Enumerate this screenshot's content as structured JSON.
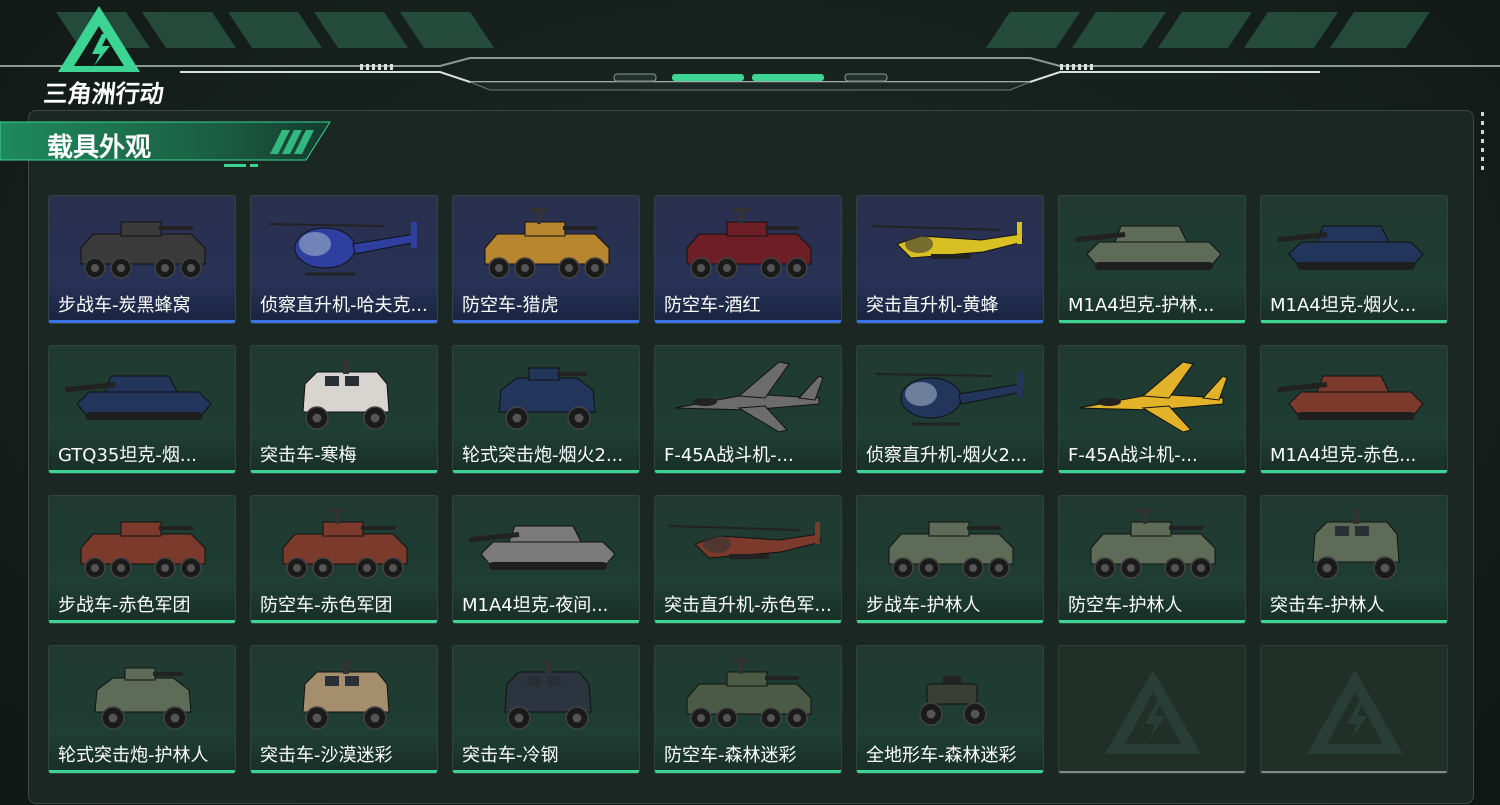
{
  "app": {
    "logo_text": "三角洲行动"
  },
  "section": {
    "title": "载具外观"
  },
  "colors": {
    "accent": "#3bd493",
    "rare": "#3a73e8",
    "empty": "#7f8a86"
  },
  "vehicles": [
    {
      "label": "步战车-炭黑蜂窝",
      "rarity": "rare",
      "icon": "ifv-icon",
      "tint": "#3a3a3a"
    },
    {
      "label": "侦察直升机-哈夫克...",
      "rarity": "rare",
      "icon": "scout-helicopter-icon",
      "tint": "#2f3fa0"
    },
    {
      "label": "防空车-猎虎",
      "rarity": "rare",
      "icon": "aa-vehicle-icon",
      "tint": "#b8862e"
    },
    {
      "label": "防空车-酒红",
      "rarity": "rare",
      "icon": "aa-vehicle-icon",
      "tint": "#6e1f26"
    },
    {
      "label": "突击直升机-黄蜂",
      "rarity": "rare",
      "icon": "attack-helicopter-icon",
      "tint": "#d8c024"
    },
    {
      "label": "M1A4坦克-护林...",
      "rarity": "common",
      "icon": "tank-icon",
      "tint": "#5d6b57"
    },
    {
      "label": "M1A4坦克-烟火...",
      "rarity": "common",
      "icon": "tank-icon",
      "tint": "#22355a"
    },
    {
      "label": "GTQ35坦克-烟...",
      "rarity": "common",
      "icon": "tank-icon",
      "tint": "#22355a"
    },
    {
      "label": "突击车-寒梅",
      "rarity": "common",
      "icon": "assault-vehicle-icon",
      "tint": "#d8d4d0"
    },
    {
      "label": "轮式突击炮-烟火2...",
      "rarity": "common",
      "icon": "wheeled-gun-icon",
      "tint": "#22355a"
    },
    {
      "label": "F-45A战斗机-...",
      "rarity": "common",
      "icon": "fighter-jet-icon",
      "tint": "#6c6c6c"
    },
    {
      "label": "侦察直升机-烟火2...",
      "rarity": "common",
      "icon": "scout-helicopter-icon",
      "tint": "#22355a"
    },
    {
      "label": "F-45A战斗机-...",
      "rarity": "common",
      "icon": "fighter-jet-icon",
      "tint": "#e2b228"
    },
    {
      "label": "M1A4坦克-赤色...",
      "rarity": "common",
      "icon": "tank-icon",
      "tint": "#7b3a2c"
    },
    {
      "label": "步战车-赤色军团",
      "rarity": "common",
      "icon": "ifv-icon",
      "tint": "#7b3a2c"
    },
    {
      "label": "防空车-赤色军团",
      "rarity": "common",
      "icon": "aa-vehicle-icon",
      "tint": "#7b3a2c"
    },
    {
      "label": "M1A4坦克-夜间...",
      "rarity": "common",
      "icon": "tank-icon",
      "tint": "#7a7a7a"
    },
    {
      "label": "突击直升机-赤色军...",
      "rarity": "common",
      "icon": "attack-helicopter-icon",
      "tint": "#7b3a2c"
    },
    {
      "label": "步战车-护林人",
      "rarity": "common",
      "icon": "ifv-icon",
      "tint": "#5d6b57"
    },
    {
      "label": "防空车-护林人",
      "rarity": "common",
      "icon": "aa-vehicle-icon",
      "tint": "#5d6b57"
    },
    {
      "label": "突击车-护林人",
      "rarity": "common",
      "icon": "assault-vehicle-icon",
      "tint": "#5d6b57"
    },
    {
      "label": "轮式突击炮-护林人",
      "rarity": "common",
      "icon": "wheeled-gun-icon",
      "tint": "#5d6b57"
    },
    {
      "label": "突击车-沙漠迷彩",
      "rarity": "common",
      "icon": "assault-vehicle-icon",
      "tint": "#a48e6e"
    },
    {
      "label": "突击车-冷钢",
      "rarity": "common",
      "icon": "assault-vehicle-icon",
      "tint": "#2c3440"
    },
    {
      "label": "防空车-森林迷彩",
      "rarity": "common",
      "icon": "aa-vehicle-icon",
      "tint": "#4b5a44"
    },
    {
      "label": "全地形车-森林迷彩",
      "rarity": "common",
      "icon": "atv-icon",
      "tint": "#3a3f36"
    },
    {
      "label": "",
      "rarity": "empty",
      "icon": "empty-slot-icon",
      "tint": ""
    },
    {
      "label": "",
      "rarity": "empty",
      "icon": "empty-slot-icon",
      "tint": ""
    }
  ]
}
